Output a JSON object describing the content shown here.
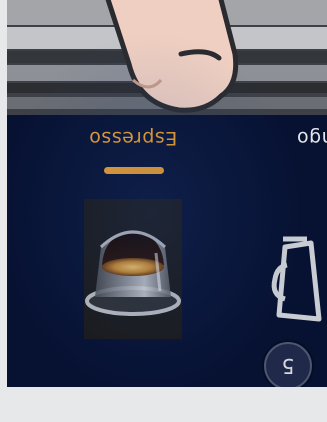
{
  "step": {
    "number": "5"
  },
  "drinks": [
    {
      "label": "Espresso",
      "selected": true,
      "icon": "espresso-cup-icon"
    },
    {
      "label": "Lungo",
      "selected": false,
      "icon": "lungo-cup-icon"
    }
  ],
  "colors": {
    "screen_background": "#071233",
    "accent": "#f0a12b",
    "label_text": "#e7e7ea"
  },
  "hand": {
    "icon": "pointing-finger-icon"
  }
}
